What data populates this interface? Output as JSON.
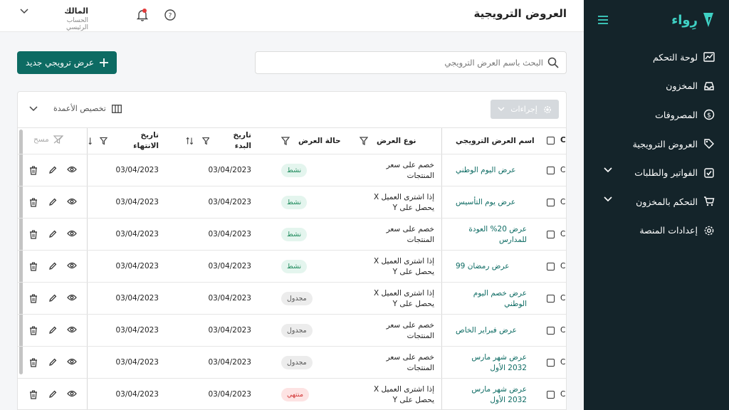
{
  "brand": {
    "name": "رِواء",
    "color": "#3fd1c4"
  },
  "sidebar": {
    "items": [
      {
        "label": "لوحة التحكم",
        "icon": "chart-line-icon"
      },
      {
        "label": "المخزون",
        "icon": "inbox-tray-icon"
      },
      {
        "label": "المصروفات",
        "icon": "dollar-circle-icon"
      },
      {
        "label": "العروض الترويجية",
        "icon": "tag-icon"
      },
      {
        "label": "الفواتير والطلبات",
        "icon": "checkbox-square-icon",
        "expandable": true
      },
      {
        "label": "التحكم بالمخزون",
        "icon": "cart-icon",
        "expandable": true
      },
      {
        "label": "إعدادات المنصة",
        "icon": "gear-icon"
      }
    ]
  },
  "header": {
    "title": "العروض الترويجية",
    "user_name": "المالك",
    "user_role": "الحساب الرئيسي"
  },
  "toolbar": {
    "add_label": "عرض ترويجي جديد",
    "search_placeholder": "البحث باسم العرض الترويجي"
  },
  "table_controls": {
    "actions_label": "إجراءات",
    "customize_columns_label": "تخصيص الأعمدة",
    "clear_label": "مسح"
  },
  "table": {
    "checkbox_col_cut": "Cl",
    "columns": {
      "name": "اسم العرض الترويجي",
      "type": "نوع العرض",
      "status": "حالة العرض",
      "start": "تاريخ البدء",
      "end": "تاريخ الانتهاء"
    },
    "rows": [
      {
        "cut": "Cl",
        "name": "عرض اليوم الوطني",
        "type": "خصم على سعر المنتجات",
        "status": "نشط",
        "start": "03/04/2023",
        "end": "03/04/2023"
      },
      {
        "cut": "Cl",
        "name": "عرض يوم التأسيس",
        "type": "إذا اشترى العميل X يحصل على Y",
        "status": "نشط",
        "start": "03/04/2023",
        "end": "03/04/2023"
      },
      {
        "cut": "Cl",
        "name": "عرض 20% العودة للمدارس",
        "type": "خصم على سعر المنتجات",
        "status": "نشط",
        "start": "03/04/2023",
        "end": "03/04/2023"
      },
      {
        "cut": "Cl",
        "name": "عرض رمضان 99",
        "type": "إذا اشترى العميل X يحصل على Y",
        "status": "نشط",
        "start": "03/04/2023",
        "end": "03/04/2023"
      },
      {
        "cut": "Cl",
        "name": "عرض خصم اليوم الوطني",
        "type": "إذا اشترى العميل X يحصل على Y",
        "status": "مجدول",
        "start": "03/04/2023",
        "end": "03/04/2023"
      },
      {
        "cut": "Cl",
        "name": "عرض فبراير الخاص",
        "type": "خصم على سعر المنتجات",
        "status": "مجدول",
        "start": "03/04/2023",
        "end": "03/04/2023"
      },
      {
        "cut": "Cl",
        "name": "عرض شهر مارس 2032 الأول",
        "type": "خصم على سعر المنتجات",
        "status": "مجدول",
        "start": "03/04/2023",
        "end": "03/04/2023"
      },
      {
        "cut": "Cl",
        "name": "عرض شهر مارس 2032 الأول",
        "type": "إذا اشترى العميل X يحصل على Y",
        "status": "منتهي",
        "start": "03/04/2023",
        "end": "03/04/2023"
      }
    ]
  },
  "status_colors": {
    "نشط": {
      "bg": "#e4f5ee",
      "fg": "#1f8a5c"
    },
    "مجدول": {
      "bg": "#ececec",
      "fg": "#555555"
    },
    "منتهي": {
      "bg": "#fde3e3",
      "fg": "#d33a3a"
    }
  },
  "colors": {
    "primary": "#0d6b63",
    "sidebar_bg": "#14242a"
  }
}
